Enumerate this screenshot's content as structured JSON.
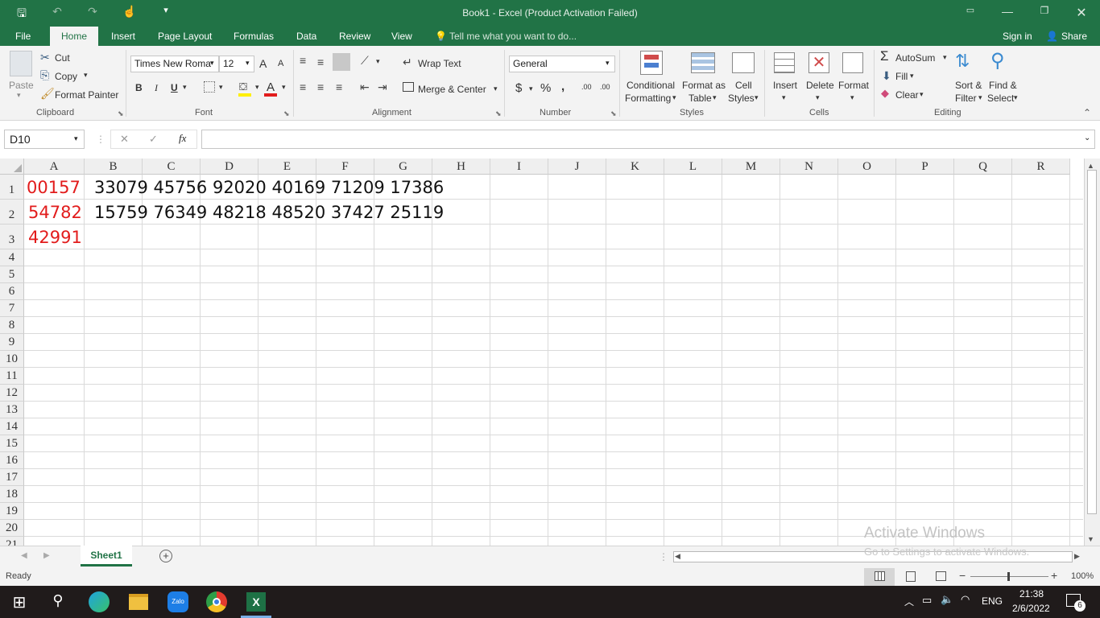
{
  "window": {
    "title": "Book1 - Excel (Product Activation Failed)"
  },
  "qat": {
    "save": "🖫",
    "undo": "↶",
    "redo": "↷",
    "touch": "☝",
    "more": "▾"
  },
  "tabs": [
    "File",
    "Home",
    "Insert",
    "Page Layout",
    "Formulas",
    "Data",
    "Review",
    "View"
  ],
  "tell_me": "Tell me what you want to do...",
  "sign_in": "Sign in",
  "share": "Share",
  "clipboard": {
    "paste": "Paste",
    "cut": "Cut",
    "copy": "Copy",
    "format_painter": "Format Painter",
    "group": "Clipboard"
  },
  "font": {
    "name": "Times New Roma",
    "size": "12",
    "bold": "B",
    "italic": "I",
    "underline": "U",
    "group": "Font",
    "grow": "A",
    "shrink": "A",
    "color_a": "A"
  },
  "alignment": {
    "wrap": "Wrap Text",
    "merge": "Merge & Center",
    "group": "Alignment"
  },
  "number": {
    "format": "General",
    "currency": "$",
    "percent": "%",
    "comma": ",",
    "inc_dec": ".00",
    "dec_dec": ".00",
    "group": "Number"
  },
  "styles": {
    "cond1": "Conditional",
    "cond2": "Formatting",
    "fmt1": "Format as",
    "fmt2": "Table",
    "cell1": "Cell",
    "cell2": "Styles",
    "group": "Styles"
  },
  "cells": {
    "insert": "Insert",
    "delete": "Delete",
    "format": "Format",
    "group": "Cells"
  },
  "editing": {
    "autosum": "AutoSum",
    "fill": "Fill",
    "clear": "Clear",
    "sort1": "Sort &",
    "sort2": "Filter",
    "find1": "Find &",
    "find2": "Select",
    "group": "Editing"
  },
  "formula_bar": {
    "name_box": "D10",
    "cancel": "✕",
    "enter": "✓",
    "fx": "fx",
    "value": ""
  },
  "columns": [
    "A",
    "B",
    "C",
    "D",
    "E",
    "F",
    "G",
    "H",
    "I",
    "J",
    "K",
    "L",
    "M",
    "N",
    "O",
    "P",
    "Q",
    "R"
  ],
  "rows": [
    "1",
    "2",
    "3",
    "4",
    "5",
    "6",
    "7",
    "8",
    "9",
    "10",
    "11",
    "12",
    "13",
    "14",
    "15",
    "16",
    "17",
    "18",
    "19",
    "20",
    "21"
  ],
  "cells_data": {
    "a1": "00157",
    "a2": "54782",
    "a3": "42991",
    "b1": "33079 45756 92020 40169 71209 17386",
    "b2": "15759 76349 48218 48520 37427 25119"
  },
  "colors": {
    "accent": "#217346",
    "red_text": "#e21c1c"
  },
  "sheet": {
    "tab": "Sheet1",
    "add": "+"
  },
  "watermark": {
    "line1": "Activate Windows",
    "line2": "Go to Settings to activate Windows."
  },
  "status": {
    "ready": "Ready",
    "zoom": "100%",
    "minus": "−",
    "plus": "+"
  },
  "taskbar": {
    "lang": "ENG",
    "time": "21:38",
    "date": "2/6/2022",
    "notif": "6",
    "zalo": "Zalo",
    "excel": "X"
  }
}
